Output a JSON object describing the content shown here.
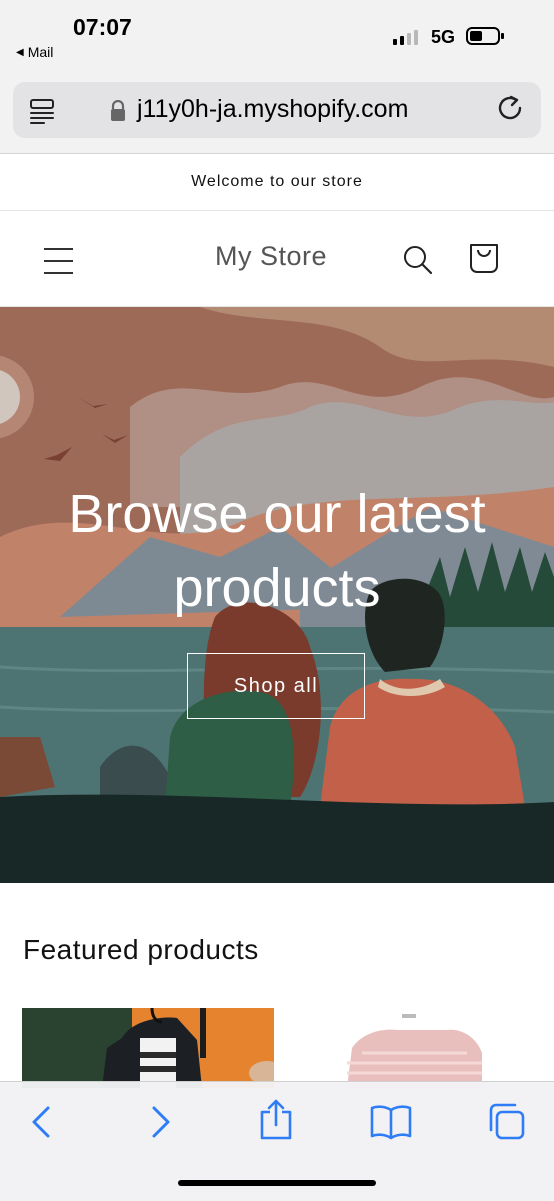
{
  "status_bar": {
    "time": "07:07",
    "back_app": "Mail",
    "network": "5G"
  },
  "browser": {
    "url": "j11y0h-ja.myshopify.com"
  },
  "announcement": "Welcome to our store",
  "header": {
    "store_name": "My Store"
  },
  "hero": {
    "title_line1": "Browse our latest",
    "title_line2": "products",
    "button_label": "Shop all"
  },
  "featured": {
    "heading": "Featured products"
  },
  "colors": {
    "accent": "#2f7df6",
    "hero_sky": "#9d6a58",
    "hero_water": "#4d7473",
    "hero_ground": "#182826"
  },
  "icons": [
    "reader-icon",
    "lock-icon",
    "reload-icon",
    "menu-icon",
    "search-icon",
    "cart-icon",
    "back-icon",
    "forward-icon",
    "share-icon",
    "bookmarks-icon",
    "tabs-icon"
  ]
}
